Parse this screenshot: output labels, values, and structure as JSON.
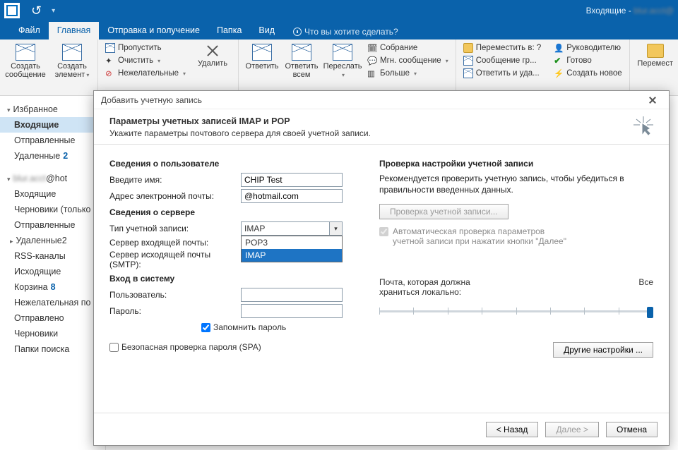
{
  "titlebar": {
    "title_right": "Входящие - "
  },
  "tabs": {
    "file": "Файл",
    "home": "Главная",
    "sendreceive": "Отправка и получение",
    "folder": "Папка",
    "view": "Вид",
    "tell": "Что вы хотите сделать?"
  },
  "ribbon": {
    "new_msg": "Создать сообщение",
    "new_item": "Создать элемент",
    "skip": "Пропустить",
    "clean": "Очистить",
    "junk": "Нежелательные",
    "delete": "Удалить",
    "reply": "Ответить",
    "reply_all": "Ответить всем",
    "forward": "Переслать",
    "meeting": "Собрание",
    "im": "Мгн. сообщение",
    "more": "Больше",
    "move_to": "Переместить в: ?",
    "team_msg": "Сообщение гр...",
    "reply_del": "Ответить и уда...",
    "manager": "Руководителю",
    "done": "Готово",
    "create_new": "Создать новое",
    "move": "Перемест"
  },
  "nav": {
    "favorites": "Избранное",
    "inbox": "Входящие",
    "sent": "Отправленные",
    "deleted": "Удаленные",
    "deleted_cnt": "2",
    "acct": "@hot",
    "acct_inbox": "Входящие",
    "drafts": "Черновики (только",
    "acct_sent": "Отправленные",
    "acct_deleted": "Удаленные",
    "acct_deleted_cnt": "2",
    "rss": "RSS-каналы",
    "outbox": "Исходящие",
    "trash": "Корзина",
    "trash_cnt": "8",
    "junk": "Нежелательная по",
    "sent2": "Отправлено",
    "drafts2": "Черновики",
    "search": "Папки поиска"
  },
  "dlg": {
    "title": "Добавить учетную запись",
    "h1": "Параметры учетных записей IMAP и POP",
    "h2": "Укажите параметры почтового сервера для своей учетной записи.",
    "user_sect": "Сведения о пользователе",
    "name_lbl": "Введите имя:",
    "name_val": "CHIP Test",
    "email_lbl": "Адрес электронной почты:",
    "email_val": "@hotmail.com",
    "srv_sect": "Сведения о сервере",
    "type_lbl": "Тип учетной записи:",
    "type_val": "IMAP",
    "type_opts": [
      "POP3",
      "IMAP"
    ],
    "in_lbl": "Сервер входящей почты:",
    "out_lbl": "Сервер исходящей почты (SMTP):",
    "login_sect": "Вход в систему",
    "user_lbl": "Пользователь:",
    "pass_lbl": "Пароль:",
    "remember": "Запомнить пароль",
    "spa": "Безопасная проверка пароля (SPA)",
    "test_sect": "Проверка настройки учетной записи",
    "test_blurb": "Рекомендуется проверить учетную запись, чтобы убедиться в правильности введенных данных.",
    "test_btn": "Проверка учетной записи...",
    "auto_test": "Автоматическая проверка параметров учетной записи при нажатии кнопки \"Далее\"",
    "slider_lbl": "Почта, которая должна храниться локально:",
    "slider_all": "Все",
    "more": "Другие настройки ...",
    "back": "< Назад",
    "next": "Далее >",
    "cancel": "Отмена"
  }
}
